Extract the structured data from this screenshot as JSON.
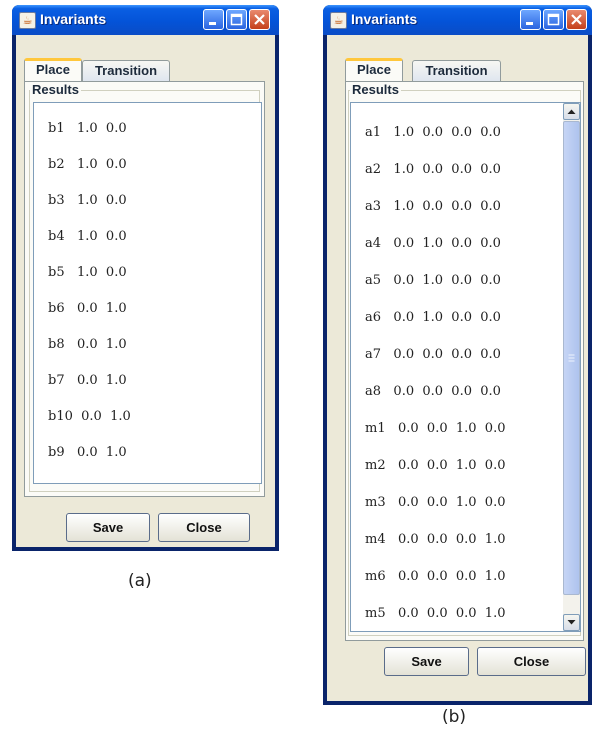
{
  "window_a": {
    "title": "Invariants",
    "tabs": [
      "Place",
      "Transition"
    ],
    "active_tab": "Place",
    "group_label": "Results",
    "rows": [
      "b1   1.0  0.0",
      "b2   1.0  0.0",
      "b3   1.0  0.0",
      "b4   1.0  0.0",
      "b5   1.0  0.0",
      "b6   0.0  1.0",
      "b8   0.0  1.0",
      "b7   0.0  1.0",
      "b10  0.0  1.0",
      "b9   0.0  1.0"
    ],
    "save_label": "Save",
    "close_label": "Close"
  },
  "window_b": {
    "title": "Invariants",
    "tabs": [
      "Place",
      "Transition"
    ],
    "active_tab": "Place",
    "group_label": "Results",
    "rows": [
      "a1   1.0  0.0  0.0  0.0",
      "a2   1.0  0.0  0.0  0.0",
      "a3   1.0  0.0  0.0  0.0",
      "a4   0.0  1.0  0.0  0.0",
      "a5   0.0  1.0  0.0  0.0",
      "a6   0.0  1.0  0.0  0.0",
      "a7   0.0  0.0  0.0  0.0",
      "a8   0.0  0.0  0.0  0.0",
      "m1   0.0  0.0  1.0  0.0",
      "m2   0.0  0.0  1.0  0.0",
      "m3   0.0  0.0  1.0  0.0",
      "m4   0.0  0.0  0.0  1.0",
      "m6   0.0  0.0  0.0  1.0",
      "m5   0.0  0.0  0.0  1.0"
    ],
    "save_label": "Save",
    "close_label": "Close"
  },
  "captions": {
    "a": "(a)",
    "b": "(b)"
  },
  "icons": {
    "title_icon": "java-cup-icon",
    "minimize": "minimize-icon",
    "maximize": "maximize-icon",
    "close": "close-icon"
  }
}
